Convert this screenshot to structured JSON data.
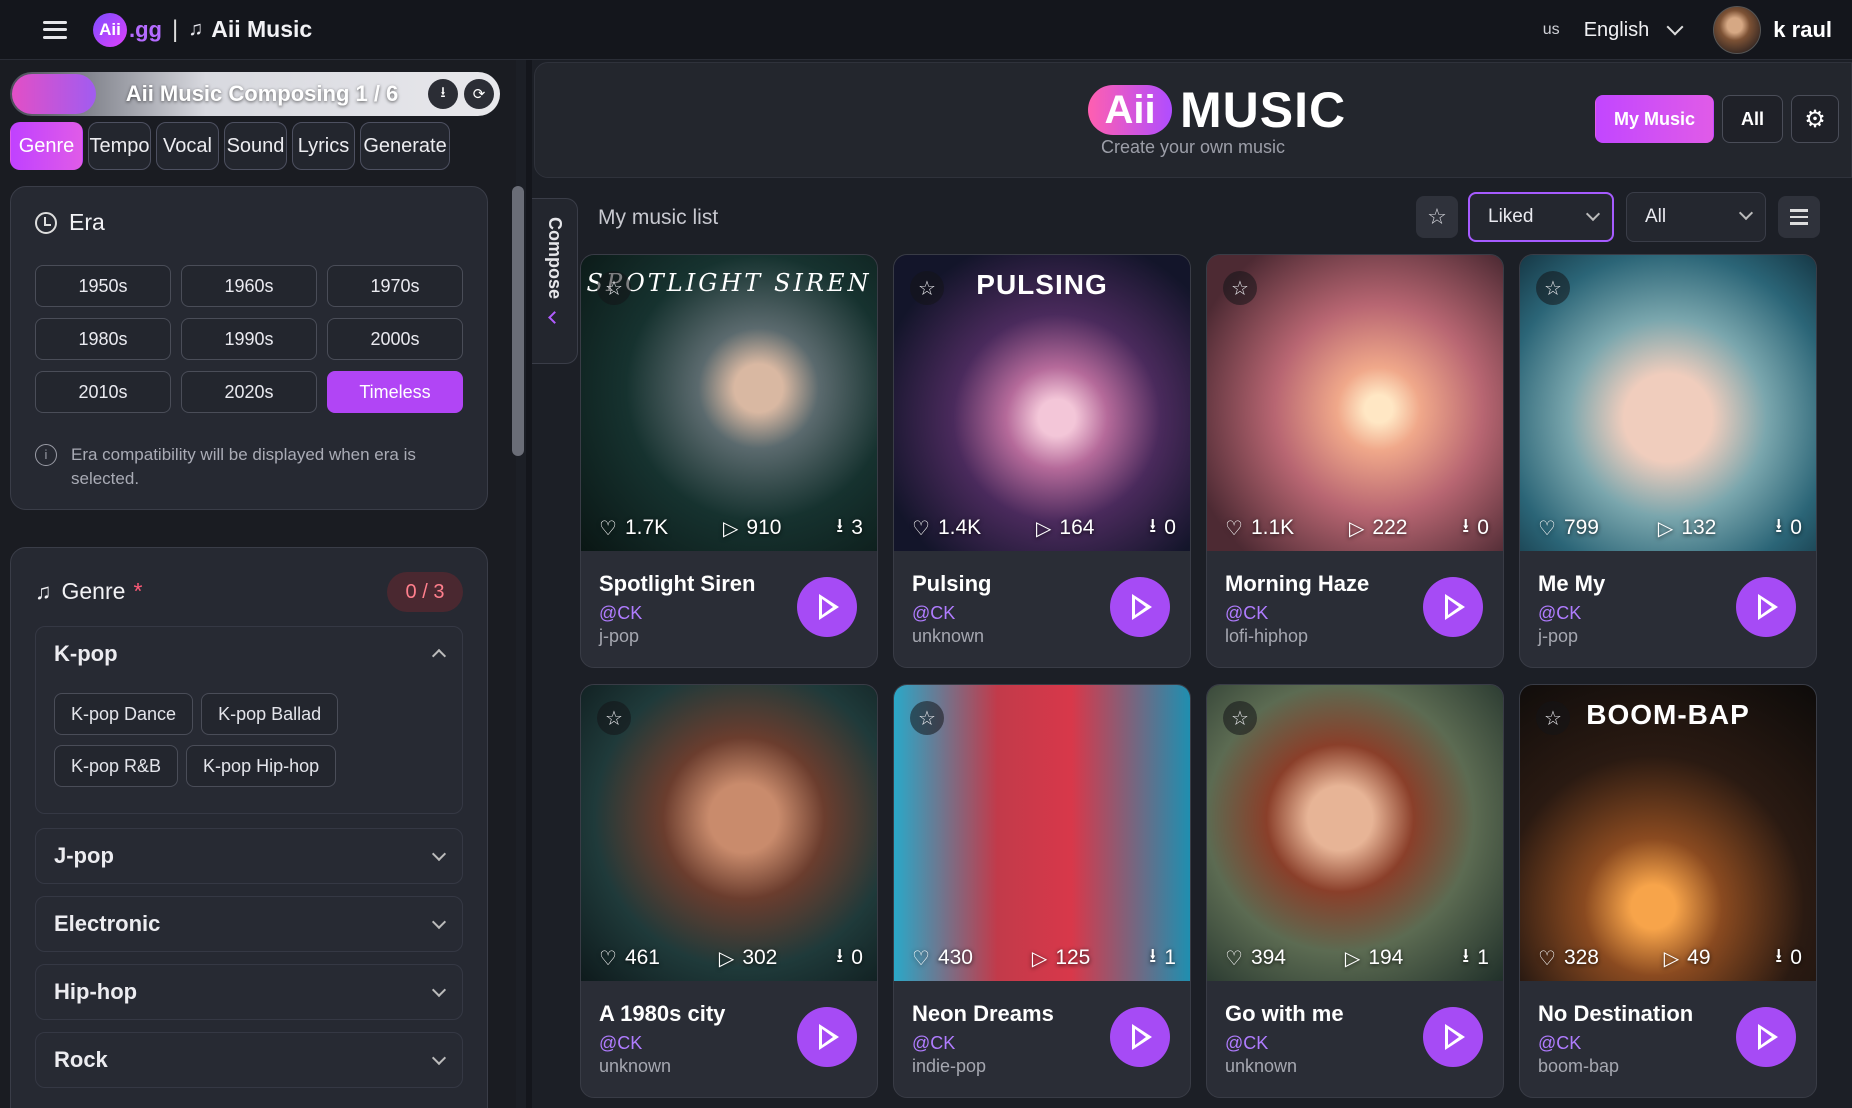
{
  "topbar": {
    "brand_logo": "Aii",
    "brand_suffix": ".gg",
    "brand_separator": "|",
    "brand_note_icon": "♫",
    "brand_name": "Aii Music",
    "lang_code": "us",
    "language": "English",
    "username": "k raul"
  },
  "composer": {
    "title": "Aii Music Composing 1 / 6",
    "download_icon": "⭳",
    "refresh_icon": "⟳",
    "tabs": [
      "Genre",
      "Tempo",
      "Vocal",
      "Sound",
      "Lyrics",
      "Generate"
    ],
    "active_tab": "Genre"
  },
  "era": {
    "title": "Era",
    "options": [
      "1950s",
      "1960s",
      "1970s",
      "1980s",
      "1990s",
      "2000s",
      "2010s",
      "2020s",
      "Timeless"
    ],
    "selected": "Timeless",
    "info": "Era compatibility will be displayed when era is selected."
  },
  "genre": {
    "title": "Genre",
    "required_mark": "*",
    "count": "0 / 3",
    "groups": [
      {
        "name": "K-pop",
        "expanded": true,
        "items": [
          "K-pop Dance",
          "K-pop Ballad",
          "K-pop R&B",
          "K-pop Hip-hop"
        ]
      },
      {
        "name": "J-pop",
        "expanded": false
      },
      {
        "name": "Electronic",
        "expanded": false
      },
      {
        "name": "Hip-hop",
        "expanded": false
      },
      {
        "name": "Rock",
        "expanded": false
      }
    ]
  },
  "compose_handle": "Compose",
  "header": {
    "logo_aii": "Aii",
    "logo_music": "MUSIC",
    "subtitle": "Create your own music",
    "my_music": "My Music",
    "all": "All",
    "settings_icon": "⚙"
  },
  "list": {
    "title": "My music list",
    "filter_liked": "Liked",
    "filter_all": "All"
  },
  "icons": {
    "star": "☆",
    "heart": "♡",
    "play": "▷",
    "download": "⭳"
  },
  "colors": {
    "accent": "#a64bf5",
    "artist": "#b07cff"
  },
  "tracks": [
    {
      "name": "Spotlight Siren",
      "artist": "@CK",
      "genre": "j-pop",
      "likes": "1.7K",
      "plays": "910",
      "downloads": "3",
      "cover_text": "SPOTLIGHT SIREN",
      "cover_style": "serif",
      "bg": "radial-gradient(circle at 60% 45%, #d9b8a2 0 10%, #5b6a6e 25%, #16322f 55%, #0a1614 100%)"
    },
    {
      "name": "Pulsing",
      "artist": "@CK",
      "genre": "unknown",
      "likes": "1.4K",
      "plays": "164",
      "downloads": "0",
      "cover_text": "PULSING",
      "cover_style": "sans",
      "bg": "radial-gradient(ellipse at 55% 55%, #f3c6d8 0 8%, #b56a9a 22%, #4a2a5c 45%, #13152a 80%)"
    },
    {
      "name": "Morning Haze",
      "artist": "@CK",
      "genre": "lofi-hiphop",
      "likes": "1.1K",
      "plays": "222",
      "downloads": "0",
      "cover_text": "",
      "cover_style": "sans",
      "bg": "radial-gradient(circle at 58% 52%, #ffe7c4 0 6%, #f0a88a 18%, #b86672 45%, #4d2a33 85%)"
    },
    {
      "name": "Me My",
      "artist": "@CK",
      "genre": "j-pop",
      "likes": "799",
      "plays": "132",
      "downloads": "0",
      "cover_text": "",
      "cover_style": "sans",
      "bg": "radial-gradient(circle at 50% 55%, #f0cdbd 0 20%, #7aa6ad 45%, #2b6577 75%, #163846 100%)"
    },
    {
      "name": "A 1980s city",
      "artist": "@CK",
      "genre": "unknown",
      "likes": "461",
      "plays": "302",
      "downloads": "0",
      "cover_text": "",
      "cover_style": "sans",
      "bg": "radial-gradient(circle at 55% 45%, #c98b6c 0 15%, #6b3d2e 35%, #1f3a3a 65%, #0e1a1c 100%)"
    },
    {
      "name": "Neon Dreams",
      "artist": "@CK",
      "genre": "indie-pop",
      "likes": "430",
      "plays": "125",
      "downloads": "1",
      "cover_text": "",
      "cover_style": "sans",
      "bg": "linear-gradient(90deg, #2aa8c8 0%, #c23a4a 35%, #d8384a 60%, #1f8fb0 100%)"
    },
    {
      "name": "Go with me",
      "artist": "@CK",
      "genre": "unknown",
      "likes": "394",
      "plays": "194",
      "downloads": "1",
      "cover_text": "",
      "cover_style": "sans",
      "bg": "radial-gradient(circle at 45% 45%, #e7b496 0 14%, #8a3f2a 32%, #5c6b52 58%, #20302a 100%)"
    },
    {
      "name": "No Destination",
      "artist": "@CK",
      "genre": "boom-bap",
      "likes": "328",
      "plays": "49",
      "downloads": "0",
      "cover_text": "BOOM-BAP",
      "cover_style": "sans",
      "bg": "radial-gradient(circle at 45% 75%, #f7a44a 0 8%, #8a4a20 25%, #2a1a12 55%, #0d0b0a 100%)"
    }
  ]
}
